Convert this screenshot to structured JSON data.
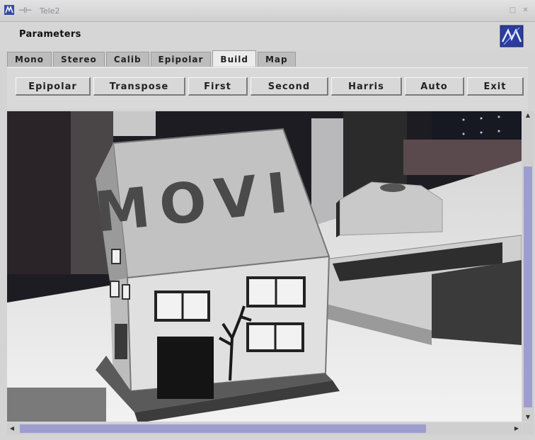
{
  "window": {
    "title": "Tele2"
  },
  "parameters": {
    "label": "Parameters"
  },
  "tabs": [
    {
      "label": "Mono",
      "active": false
    },
    {
      "label": "Stereo",
      "active": false
    },
    {
      "label": "Calib",
      "active": false
    },
    {
      "label": "Epipolar",
      "active": false
    },
    {
      "label": "Build",
      "active": true
    },
    {
      "label": "Map",
      "active": false
    }
  ],
  "buttons": [
    {
      "label": "Epipolar"
    },
    {
      "label": "Transpose"
    },
    {
      "label": "First"
    },
    {
      "label": "Second"
    },
    {
      "label": "Harris"
    },
    {
      "label": "Auto"
    },
    {
      "label": "Exit"
    }
  ],
  "image": {
    "house_sign": "MOVI"
  },
  "icons": {
    "app": "app-icon",
    "pin": "pin-icon",
    "logo": "movi-logo-icon"
  },
  "colors": {
    "scroll_thumb": "#9d9ecf",
    "active_tab": "#ececec"
  }
}
